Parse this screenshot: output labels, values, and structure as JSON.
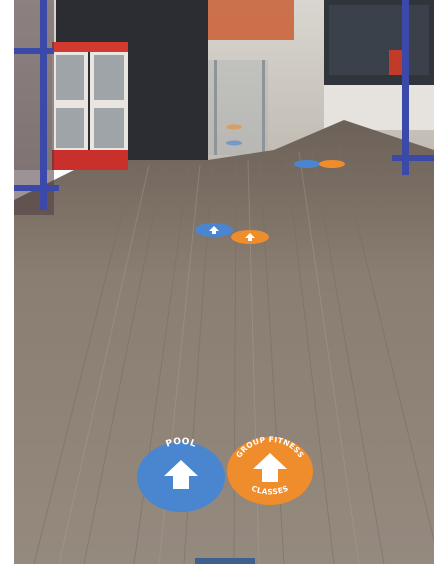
{
  "scene": {
    "description_subject": "gym corridor floor with directional decals",
    "colors": {
      "floor": "#8b7e72",
      "floor_light": "#a3978a",
      "wall_dark": "#2b2d33",
      "blue_decal": "#4a86d0",
      "orange_decal": "#ef8c2c",
      "cage_blue": "#3b4aa8"
    }
  },
  "decals": {
    "pool": {
      "label": "POOL",
      "icon": "up-arrow-icon"
    },
    "group_fitness": {
      "label_top": "GROUP FITNESS",
      "label_bottom": "CLASSES",
      "icon": "up-arrow-icon"
    }
  }
}
